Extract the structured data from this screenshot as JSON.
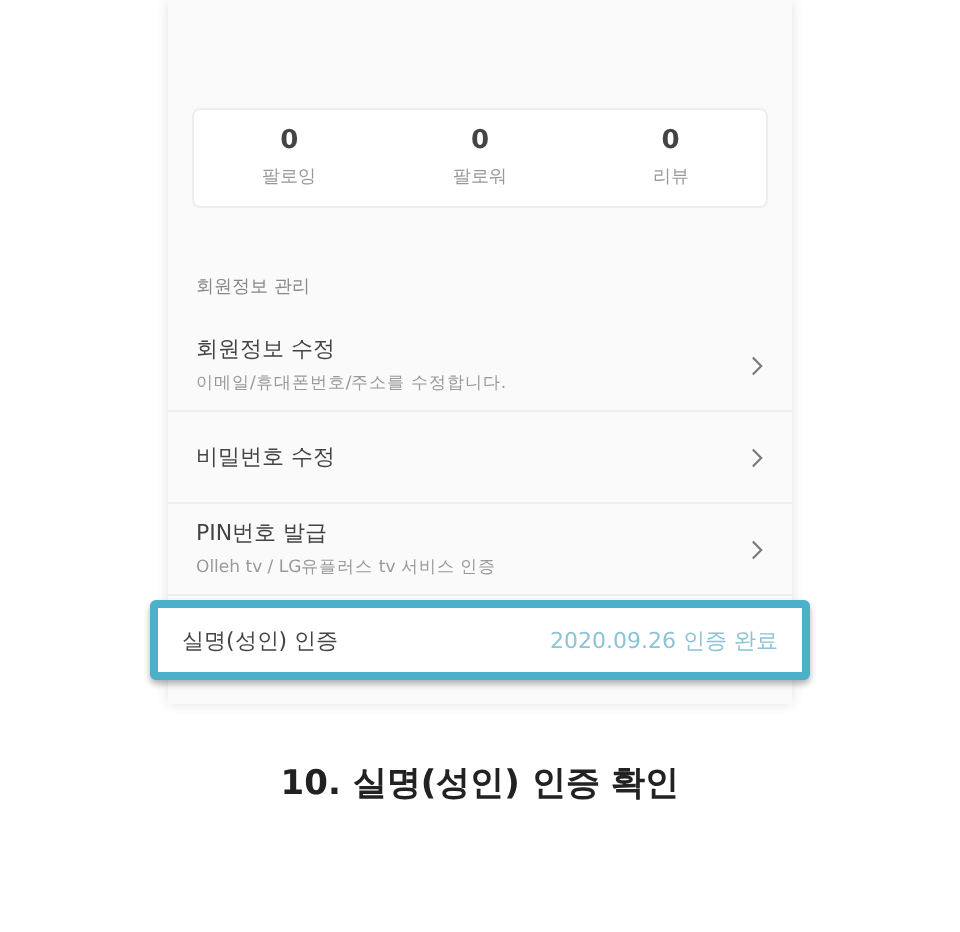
{
  "stats": [
    {
      "value": "0",
      "label": "팔로잉"
    },
    {
      "value": "0",
      "label": "팔로워"
    },
    {
      "value": "0",
      "label": "리뷰"
    }
  ],
  "section_title": "회원정보 관리",
  "menu_items": [
    {
      "kind": "link",
      "title": "회원정보 수정",
      "subtitle": "이메일/휴대폰번호/주소를 수정합니다.",
      "highlighted": false
    },
    {
      "kind": "link",
      "title": "비밀번호 수정",
      "highlighted": false
    },
    {
      "kind": "link",
      "title": "PIN번호 발급",
      "subtitle": "Olleh tv / LG유플러스 tv 서비스 인증",
      "highlighted": false
    },
    {
      "kind": "status",
      "title": "실명(성인) 인증",
      "status": "2020.09.26 인증 완료",
      "highlighted": true
    }
  ],
  "caption": "10. 실명(성인) 인증 확인"
}
